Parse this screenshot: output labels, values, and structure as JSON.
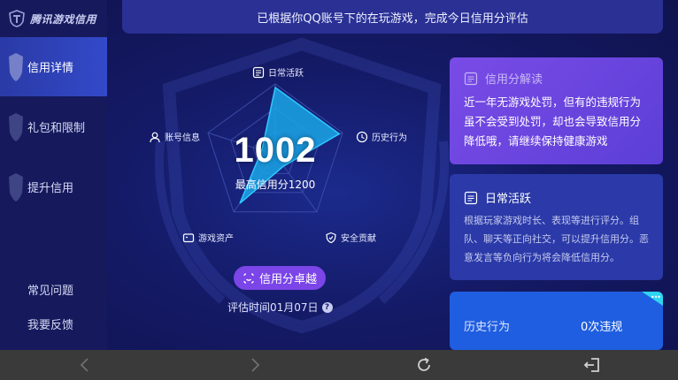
{
  "app": {
    "title": "腾讯游戏信用"
  },
  "sidebar": {
    "items": [
      {
        "label": "信用详情",
        "active": true
      },
      {
        "label": "礼包和限制",
        "active": false
      },
      {
        "label": "提升信用",
        "active": false
      }
    ],
    "bottom_links": [
      {
        "label": "常见问题"
      },
      {
        "label": "我要反馈"
      }
    ]
  },
  "banner": {
    "text": "已根据你QQ账号下的在玩游戏，完成今日信用分评估"
  },
  "radar": {
    "score": "1002",
    "max_text": "最高信用分1200",
    "dimensions": [
      {
        "label": "日常活跃",
        "icon": "doc-icon",
        "value": 0.95
      },
      {
        "label": "历史行为",
        "icon": "clock-icon",
        "value": 0.95
      },
      {
        "label": "安全贡献",
        "icon": "shield-icon",
        "value": 0.2
      },
      {
        "label": "游戏资产",
        "icon": "wallet-icon",
        "value": 0.85
      },
      {
        "label": "账号信息",
        "icon": "user-icon",
        "value": 0.2
      }
    ],
    "colors": {
      "fill": "#1aa6e6",
      "stroke": "#30c8ff",
      "grid": "#3a4aa8"
    }
  },
  "level": {
    "label": "信用分卓越",
    "icon": "smile-icon",
    "color": "#7b45e8"
  },
  "eval_time": {
    "text": "评估时间01月07日",
    "help_icon": "?"
  },
  "cards": {
    "interpret": {
      "title": "信用分解读",
      "icon": "doc-icon",
      "text": "近一年无游戏处罚，但有的违规行为虽不会受到处罚，却也会导致信用分降低哦，请继续保持健康游戏"
    },
    "daily": {
      "title": "日常活跃",
      "icon": "doc-icon",
      "text": "根据玩家游戏时长、表现等进行评分。组队、聊天等正向社交，可以提升信用分。恶意发言等负向行为将会降低信用分。"
    },
    "history": {
      "label": "历史行为",
      "value": "0次违规",
      "corner_text": "•••"
    }
  },
  "navbar": {
    "icons": [
      "back-icon",
      "forward-icon",
      "refresh-icon",
      "exit-icon"
    ]
  }
}
